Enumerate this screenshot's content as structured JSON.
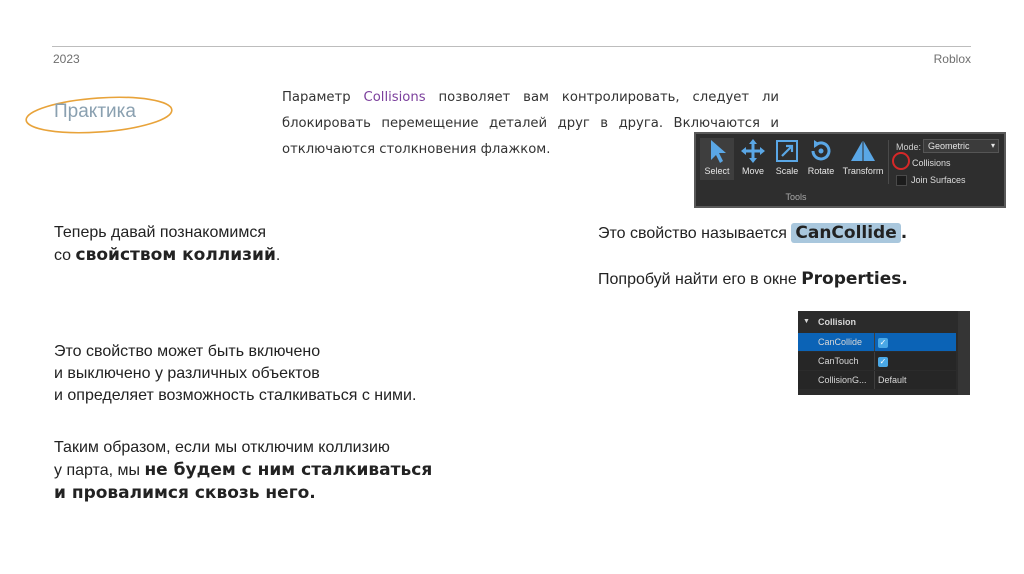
{
  "header": {
    "year": "2023",
    "brand": "Roblox"
  },
  "section_title": "Практика",
  "intro": {
    "before": "Параметр ",
    "keyword": "Collisions",
    "after": " позволяет вам контролировать, следует ли блокировать перемещение деталей друг в друга. Включаются и отключаются столкновения флажком."
  },
  "tools_panel": {
    "buttons": [
      "Select",
      "Move",
      "Scale",
      "Rotate",
      "Transform"
    ],
    "caption": "Tools",
    "mode_label": "Mode:",
    "mode_value": "Geometric",
    "collisions_label": "Collisions",
    "join_surfaces_label": "Join Surfaces"
  },
  "left": {
    "p1_line1": "Теперь давай познакомимся",
    "p1_line2_a": "со ",
    "p1_line2_bold": "свойством коллизий",
    "p1_line2_end": ".",
    "p2_line1": "Это свойство может быть включено",
    "p2_line2": "и выключено у различных объектов",
    "p2_line3": "и определяет возможность сталкиваться с ними.",
    "p3_line1": "Таким образом, если мы отключим коллизию",
    "p3_line2_a": "у парта, мы ",
    "p3_line2_bold": "не будем с ним сталкиваться",
    "p3_line3_bold": "и провалимся сквозь него",
    "p3_line3_end": "."
  },
  "right": {
    "l1_a": "Это свойство называется ",
    "l1_tag": "CanCollide",
    "l1_end": ".",
    "l2_a": "Попробуй найти его в окне ",
    "l2_bold": "Properties."
  },
  "properties_panel": {
    "group": "Collision",
    "rows": [
      {
        "name": "CanCollide",
        "value": "✓"
      },
      {
        "name": "CanTouch",
        "value": "✓"
      },
      {
        "name": "CollisionG...",
        "value": "Default"
      }
    ]
  },
  "colors": {
    "accent_orange": "#e8a33a",
    "keyword_purple": "#7b3f9c",
    "tag_blue": "#a9c7dd",
    "selected_row": "#0b63b6"
  }
}
